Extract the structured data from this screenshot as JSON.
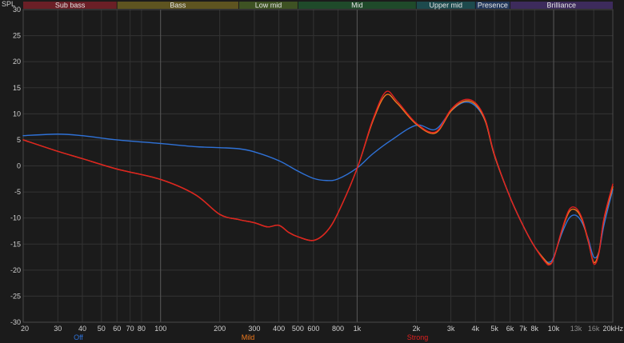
{
  "chart_data": {
    "type": "line",
    "title": "",
    "xlabel": "",
    "ylabel": "SPL",
    "x_scale": "log",
    "xlim": [
      20,
      20000
    ],
    "ylim": [
      -30,
      30
    ],
    "grid": true,
    "x_ticks": [
      {
        "value": 20,
        "label": "20"
      },
      {
        "value": 30,
        "label": "30"
      },
      {
        "value": 40,
        "label": "40"
      },
      {
        "value": 50,
        "label": "50"
      },
      {
        "value": 60,
        "label": "60"
      },
      {
        "value": 70,
        "label": "70"
      },
      {
        "value": 80,
        "label": "80"
      },
      {
        "value": 100,
        "label": "100"
      },
      {
        "value": 200,
        "label": "200"
      },
      {
        "value": 300,
        "label": "300"
      },
      {
        "value": 400,
        "label": "400"
      },
      {
        "value": 500,
        "label": "500"
      },
      {
        "value": 600,
        "label": "600"
      },
      {
        "value": 800,
        "label": "800"
      },
      {
        "value": 1000,
        "label": "1k"
      },
      {
        "value": 2000,
        "label": "2k"
      },
      {
        "value": 3000,
        "label": "3k"
      },
      {
        "value": 4000,
        "label": "4k"
      },
      {
        "value": 5000,
        "label": "5k"
      },
      {
        "value": 6000,
        "label": "6k"
      },
      {
        "value": 7000,
        "label": "7k"
      },
      {
        "value": 8000,
        "label": "8k"
      },
      {
        "value": 10000,
        "label": "10k"
      },
      {
        "value": 13000,
        "label": "13k",
        "dim": true
      },
      {
        "value": 16000,
        "label": "16k",
        "dim": true
      },
      {
        "value": 20000,
        "label": "20kHz"
      }
    ],
    "y_ticks": [
      30,
      25,
      20,
      15,
      10,
      5,
      0,
      -5,
      -10,
      -15,
      -20,
      -25,
      -30
    ],
    "bands": [
      {
        "label": "Sub bass",
        "from": 20,
        "to": 60,
        "color": "#6b1f26"
      },
      {
        "label": "Bass",
        "from": 60,
        "to": 250,
        "color": "#5e5420"
      },
      {
        "label": "Low mid",
        "from": 250,
        "to": 500,
        "color": "#3e5223"
      },
      {
        "label": "Mid",
        "from": 500,
        "to": 2000,
        "color": "#1f4a2a"
      },
      {
        "label": "Upper mid",
        "from": 2000,
        "to": 4000,
        "color": "#1d4a4d"
      },
      {
        "label": "Presence",
        "from": 4000,
        "to": 6000,
        "color": "#22375a"
      },
      {
        "label": "Brilliance",
        "from": 6000,
        "to": 20000,
        "color": "#3d2b5c"
      }
    ],
    "series": [
      {
        "name": "Off",
        "color": "#2f72d8",
        "x": [
          20,
          30,
          40,
          60,
          100,
          150,
          200,
          250,
          300,
          400,
          500,
          600,
          700,
          800,
          1000,
          1200,
          1500,
          2000,
          2500,
          3000,
          3500,
          4000,
          4500,
          5000,
          6000,
          7000,
          8000,
          9000,
          9500,
          10000,
          11000,
          12000,
          13000,
          14000,
          15000,
          16000,
          17000,
          18000,
          20000
        ],
        "y": [
          5.8,
          6.1,
          5.8,
          5.0,
          4.3,
          3.7,
          3.5,
          3.3,
          2.7,
          1.0,
          -1.0,
          -2.4,
          -2.8,
          -2.5,
          -0.4,
          2.3,
          5.0,
          7.8,
          7.0,
          10.5,
          12.2,
          11.5,
          8.5,
          2.0,
          -6.0,
          -11.5,
          -15.5,
          -18.0,
          -18.5,
          -17.5,
          -13.0,
          -10.0,
          -9.5,
          -11.0,
          -14.0,
          -17.5,
          -16.5,
          -11.5,
          -4.5
        ]
      },
      {
        "name": "Mild",
        "color": "#f07a1e",
        "x": [
          20,
          30,
          40,
          60,
          100,
          150,
          200,
          250,
          300,
          350,
          400,
          450,
          500,
          600,
          700,
          800,
          1000,
          1200,
          1400,
          1600,
          2000,
          2500,
          3000,
          3500,
          4000,
          4500,
          5000,
          6000,
          7000,
          8000,
          9000,
          9500,
          10000,
          11000,
          12000,
          13000,
          14000,
          15000,
          16000,
          17000,
          18000,
          20000
        ],
        "y": [
          5.0,
          2.8,
          1.4,
          -0.6,
          -2.6,
          -5.5,
          -9.3,
          -10.3,
          -10.9,
          -11.7,
          -11.4,
          -12.8,
          -13.6,
          -14.3,
          -12.6,
          -9.0,
          -0.5,
          8.5,
          13.6,
          12.0,
          8.0,
          6.3,
          10.5,
          12.4,
          11.8,
          8.5,
          2.0,
          -6.0,
          -11.5,
          -15.5,
          -18.0,
          -18.8,
          -17.8,
          -12.5,
          -8.8,
          -8.5,
          -10.5,
          -14.5,
          -18.5,
          -16.5,
          -10.5,
          -4.0
        ]
      },
      {
        "name": "Strong",
        "color": "#e02020",
        "x": [
          20,
          30,
          40,
          60,
          100,
          150,
          200,
          250,
          300,
          350,
          400,
          450,
          500,
          600,
          700,
          800,
          1000,
          1200,
          1400,
          1600,
          2000,
          2500,
          3000,
          3500,
          4000,
          4500,
          5000,
          6000,
          7000,
          8000,
          9000,
          9500,
          10000,
          11000,
          12000,
          13000,
          14000,
          15000,
          16000,
          17000,
          18000,
          20000
        ],
        "y": [
          5.0,
          2.8,
          1.4,
          -0.6,
          -2.6,
          -5.5,
          -9.3,
          -10.3,
          -10.9,
          -11.7,
          -11.4,
          -12.8,
          -13.6,
          -14.3,
          -12.6,
          -9.0,
          -0.5,
          8.8,
          14.2,
          12.4,
          8.2,
          6.5,
          10.8,
          12.7,
          12.1,
          8.8,
          2.2,
          -6.0,
          -11.5,
          -15.5,
          -18.3,
          -19.0,
          -17.8,
          -12.3,
          -8.4,
          -8.1,
          -10.2,
          -14.3,
          -18.8,
          -16.8,
          -10.2,
          -3.5
        ]
      }
    ]
  }
}
